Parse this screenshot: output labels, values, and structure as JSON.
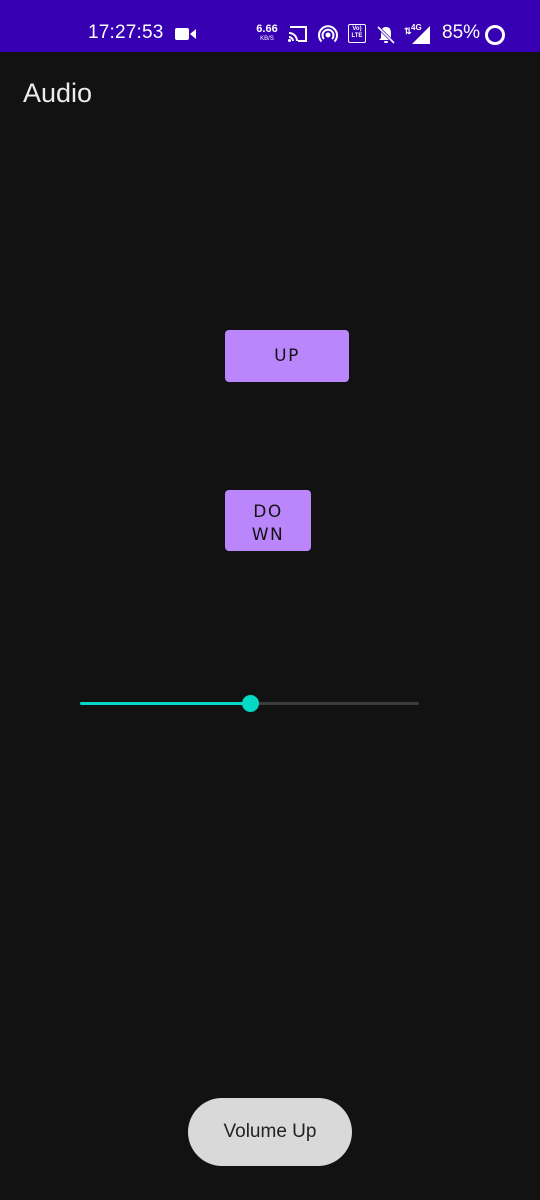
{
  "status_bar": {
    "time": "17:27:53",
    "net_speed_value": "6.66",
    "net_speed_unit": "KB/S",
    "volte_label": "Vo) LTE",
    "network_type": "4G",
    "battery_percent": "85%",
    "icons": [
      "video-record-icon",
      "cast-icon",
      "hotspot-icon",
      "volte-icon",
      "bell-off-icon",
      "signal-icon",
      "battery-ring-icon"
    ],
    "background_color": "#3700b3"
  },
  "app_bar": {
    "title": "Audio"
  },
  "controls": {
    "up_label": "UP",
    "down_label_line1": "DO",
    "down_label_line2": "WN",
    "button_color": "#bb86fc"
  },
  "volume_slider": {
    "value": 0.5,
    "accent_color": "#03dac5"
  },
  "toast": {
    "message": "Volume Up"
  }
}
